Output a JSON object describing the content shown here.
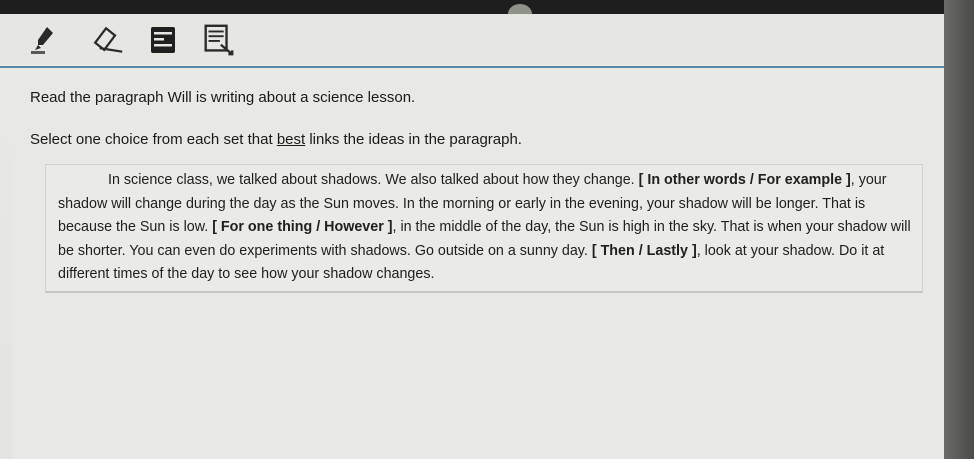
{
  "instructions": {
    "line1": "Read the paragraph Will is writing about a science lesson.",
    "line2_before": "Select one choice from each set that ",
    "line2_best": "best",
    "line2_after": " links the ideas in the paragraph."
  },
  "toolbar": {
    "tools": [
      {
        "name": "highlighter-icon"
      },
      {
        "name": "eraser-icon"
      },
      {
        "name": "notepad-icon"
      },
      {
        "name": "line-reader-icon"
      }
    ]
  },
  "passage": {
    "s1": "In science class, we talked about shadows. We also talked about how they change. ",
    "c1": {
      "open": "[ ",
      "a": "In other words",
      "sep": " / ",
      "b": "For example",
      "close": " ]"
    },
    "s2": ", your shadow will change during the day as the Sun moves. In the morning or early in the evening, your shadow will be longer. That is because the Sun is low. ",
    "c2": {
      "open": "[ ",
      "a": "For one thing",
      "sep": " / ",
      "b": "However",
      "close": " ]"
    },
    "s3": ", in the middle of the day, the Sun is high in the sky. That is when your shadow will be shorter. You can even do experiments with shadows. Go outside on a sunny day. ",
    "c3": {
      "open": "[ ",
      "a": "Then",
      "sep": " / ",
      "b": "Lastly",
      "close": " ]"
    },
    "s4": ", look at your shadow. Do it at different times of the day to see how your shadow changes."
  }
}
